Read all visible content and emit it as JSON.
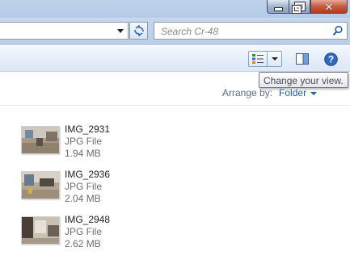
{
  "window": {
    "caption_buttons": [
      "minimize-icon",
      "restore-icon",
      "close-icon"
    ]
  },
  "search": {
    "placeholder": "Search Cr-48"
  },
  "toolbar": {
    "view_icon": "details-view-icon",
    "preview_icon": "preview-pane-icon",
    "help_icon": "help-icon"
  },
  "tooltip": {
    "text": "Change your view."
  },
  "arrange": {
    "label": "Arrange by:",
    "value": "Folder"
  },
  "files": [
    {
      "name": "IMG_2931",
      "type": "JPG File",
      "size": "1.94 MB"
    },
    {
      "name": "IMG_2936",
      "type": "JPG File",
      "size": "2.04 MB"
    },
    {
      "name": "IMG_2948",
      "type": "JPG File",
      "size": "2.62 MB"
    }
  ],
  "colors": {
    "accent": "#1f5fb0",
    "close_button": "#c75a40"
  }
}
